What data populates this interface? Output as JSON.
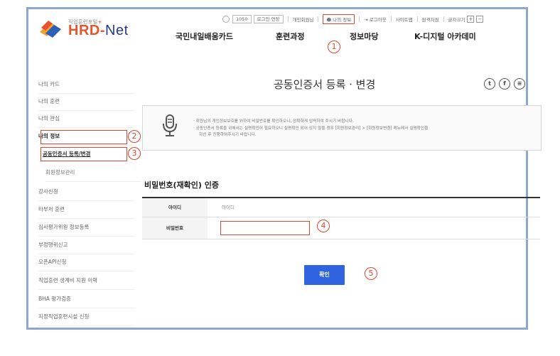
{
  "header": {
    "logo_sub": "직업훈련포털",
    "logo_star": "+",
    "logo_hrd": "HRD",
    "logo_dash": "-",
    "logo_net": "Net",
    "timer": "1050",
    "extend_label": "로그인 연장",
    "user_label": "개인회원님",
    "myinfo_label": "나의 정보",
    "logout_label": "로그아웃",
    "sitemap_label": "사이트맵",
    "remote_label": "원격지원",
    "fontsize_label": "글자크기",
    "plus": "+",
    "minus": "−"
  },
  "gnb": [
    "국민내일배움카드",
    "훈련과정",
    "정보마당",
    "K-디지털 아카데미"
  ],
  "sidebar": {
    "items": [
      "나의 카드",
      "나의 훈련",
      "나의 관심",
      "나의 정보",
      "공동인증서 등록/변경",
      "회원정보관리",
      "강사신청",
      "타부처 훈련",
      "심사평가위원 정보등록",
      "부정행위신고",
      "오픈API신청",
      "직업훈련 생계비 지원 이력",
      "BHA 평가검증",
      "지정직업훈련시설 신청"
    ]
  },
  "page_title": "공동인증서 등록 · 변경",
  "share": {
    "twitter": "t",
    "facebook": "f",
    "other": "≡"
  },
  "notice": {
    "line1": "· 회원님의 개인정보보호를 위하여 비밀번호를 확인하오니, 정확하게 입력하여 주시기 바랍니다.",
    "line2": "· 공동인증서 등록을 위해서는 실명확인이 필요하오니 실명확인 되어 있지 않을 경우 [회원정보관리] > [회원정보변경] 메뉴에서 실명확인을",
    "line3": "하신 후 진행하여주시기 바랍니다."
  },
  "section_title": "비밀번호(재확인) 인증",
  "form": {
    "id_label": "아이디",
    "id_value": "아이디",
    "pw_label": "비밀번호",
    "pw_value": ""
  },
  "confirm_label": "확인",
  "steps": [
    "1",
    "2",
    "3",
    "4",
    "5"
  ],
  "accent_color": "#e0462f",
  "button_color": "#2f63e0"
}
